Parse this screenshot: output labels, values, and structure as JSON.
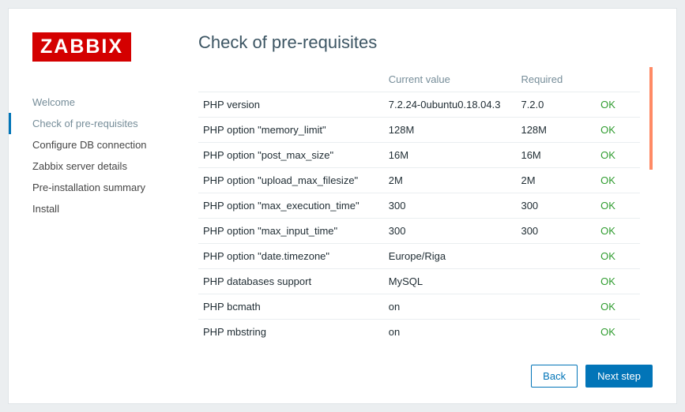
{
  "logo": "ZABBIX",
  "title": "Check of pre-requisites",
  "sidebar": {
    "items": [
      {
        "label": "Welcome",
        "state": "done"
      },
      {
        "label": "Check of pre-requisites",
        "state": "current"
      },
      {
        "label": "Configure DB connection",
        "state": "future"
      },
      {
        "label": "Zabbix server details",
        "state": "future"
      },
      {
        "label": "Pre-installation summary",
        "state": "future"
      },
      {
        "label": "Install",
        "state": "future"
      }
    ]
  },
  "table": {
    "headers": {
      "name": "",
      "current": "Current value",
      "required": "Required",
      "status": ""
    },
    "rows": [
      {
        "name": "PHP version",
        "current": "7.2.24-0ubuntu0.18.04.3",
        "required": "7.2.0",
        "status": "OK"
      },
      {
        "name": "PHP option \"memory_limit\"",
        "current": "128M",
        "required": "128M",
        "status": "OK"
      },
      {
        "name": "PHP option \"post_max_size\"",
        "current": "16M",
        "required": "16M",
        "status": "OK"
      },
      {
        "name": "PHP option \"upload_max_filesize\"",
        "current": "2M",
        "required": "2M",
        "status": "OK"
      },
      {
        "name": "PHP option \"max_execution_time\"",
        "current": "300",
        "required": "300",
        "status": "OK"
      },
      {
        "name": "PHP option \"max_input_time\"",
        "current": "300",
        "required": "300",
        "status": "OK"
      },
      {
        "name": "PHP option \"date.timezone\"",
        "current": "Europe/Riga",
        "required": "",
        "status": "OK"
      },
      {
        "name": "PHP databases support",
        "current": "MySQL",
        "required": "",
        "status": "OK"
      },
      {
        "name": "PHP bcmath",
        "current": "on",
        "required": "",
        "status": "OK"
      },
      {
        "name": "PHP mbstring",
        "current": "on",
        "required": "",
        "status": "OK"
      }
    ]
  },
  "buttons": {
    "back": "Back",
    "next": "Next step"
  }
}
